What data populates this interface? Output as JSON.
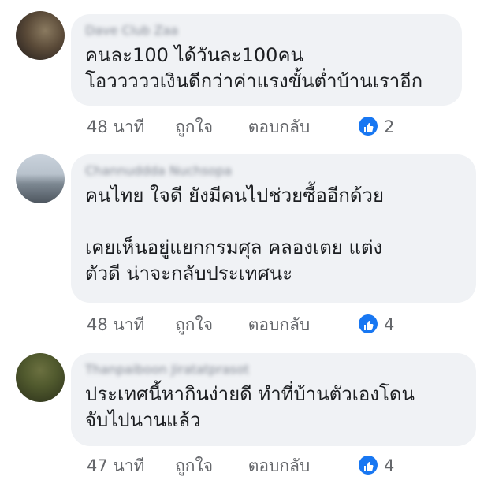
{
  "comments": [
    {
      "author": "Dave Club Zaa",
      "text": "คนละ100 ได้วันละ100คน\nโอวววววเงินดีกว่าค่าแรงขั้นต่ำบ้านเราอีก",
      "time": "48 นาที",
      "like_label": "ถูกใจ",
      "reply_label": "ตอบกลับ",
      "reaction_icon": "like-icon",
      "reaction_count": "2"
    },
    {
      "author": "Channuddda Nuchsopa",
      "text": "คนไทย ใจดี  ยังมีคนไปช่วยซื้ออีกด้วย\n\nเคยเห็นอยู่แยกกรมศุล คลองเตย แต่ง\nตัวดี น่าจะกลับประเทศนะ",
      "time": "48 นาที",
      "like_label": "ถูกใจ",
      "reply_label": "ตอบกลับ",
      "reaction_icon": "like-icon",
      "reaction_count": "4"
    },
    {
      "author": "Thanpaiboon Jiratatprasot",
      "text": "ประเทศนี้หากินง่ายดี ทำที่บ้านตัวเองโดน\nจับไปนานแล้ว",
      "time": "47 นาที",
      "like_label": "ถูกใจ",
      "reply_label": "ตอบกลับ",
      "reaction_icon": "like-icon",
      "reaction_count": "4"
    }
  ],
  "colors": {
    "bubble": "#f0f2f5",
    "text": "#1c1e21",
    "meta": "#65676b",
    "like_accent": "#1877f2"
  }
}
